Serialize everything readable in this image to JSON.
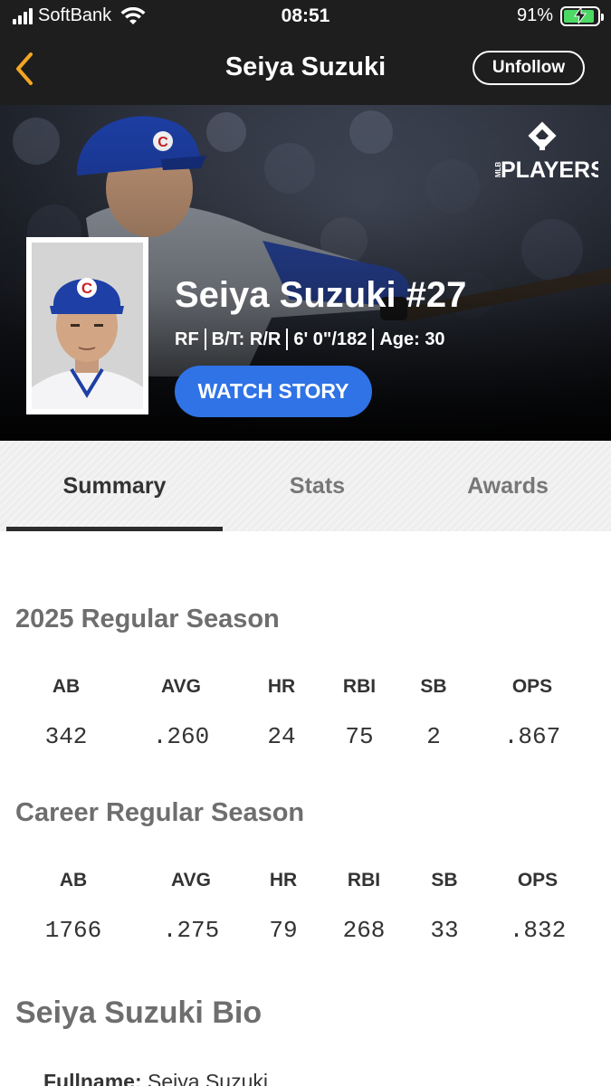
{
  "status_bar": {
    "carrier": "SoftBank",
    "time": "08:51",
    "battery_percent": "91%",
    "battery_level": 0.91,
    "charging": true
  },
  "nav": {
    "title": "Seiya Suzuki",
    "unfollow_label": "Unfollow",
    "back_icon": "chevron-left-icon"
  },
  "hero": {
    "logo_text_small": "MLB",
    "logo_text": "PLAYERS",
    "player_name": "Seiya Suzuki #27",
    "position": "RF",
    "bats_throws": "B/T: R/R",
    "height_weight": "6' 0\"/182",
    "age": "Age: 30",
    "watch_story_label": "WATCH STORY"
  },
  "tabs": [
    {
      "label": "Summary",
      "active": true
    },
    {
      "label": "Stats",
      "active": false
    },
    {
      "label": "Awards",
      "active": false
    }
  ],
  "season": {
    "title": "2025 Regular Season",
    "headers": [
      "AB",
      "AVG",
      "HR",
      "RBI",
      "SB",
      "OPS"
    ],
    "values": [
      "342",
      ".260",
      "24",
      "75",
      "2",
      ".867"
    ]
  },
  "career": {
    "title": "Career Regular Season",
    "headers": [
      "AB",
      "AVG",
      "HR",
      "RBI",
      "SB",
      "OPS"
    ],
    "values": [
      "1766",
      ".275",
      "79",
      "268",
      "33",
      ".832"
    ]
  },
  "bio": {
    "title": "Seiya Suzuki Bio",
    "fullname_label": "Fullname:",
    "fullname_value": "Seiya Suzuki"
  },
  "colors": {
    "bar_bg": "#1e1e1e",
    "accent_orange": "#f5a623",
    "watch_button": "#2f73e6",
    "cubs_blue": "#1d3fa6",
    "cubs_red": "#cc2229"
  }
}
